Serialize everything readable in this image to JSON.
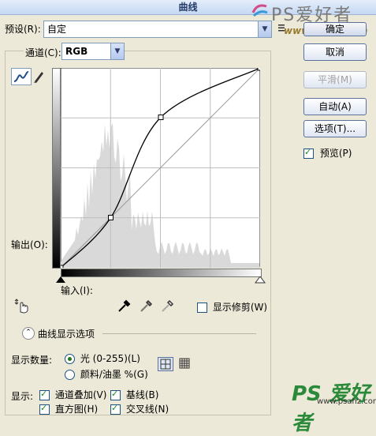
{
  "window": {
    "title": "曲线"
  },
  "preset": {
    "label": "预设(R):",
    "value": "自定"
  },
  "preset_menu_icon": "menu-icon",
  "channel": {
    "label": "通道(C):",
    "value": "RGB"
  },
  "graph": {
    "output_label": "输出(O):",
    "input_label": "输入(I):",
    "points": [
      [
        0,
        0
      ],
      [
        64,
        64
      ],
      [
        128,
        192
      ],
      [
        255,
        255
      ]
    ]
  },
  "buttons": {
    "ok": "确定",
    "cancel": "取消",
    "smooth": "平滑(M)",
    "auto": "自动(A)",
    "options": "选项(T)..."
  },
  "preview": {
    "label": "预览(P)",
    "checked": true
  },
  "show_clipping": {
    "label": "显示修剪(W)",
    "checked": false
  },
  "display_options": {
    "label": "曲线显示选项"
  },
  "show_amount": {
    "label": "显示数量:",
    "light": "光 (0-255)(L)",
    "pigment": "颜料/油墨 %(G)"
  },
  "show": {
    "label": "显示:",
    "channel_overlay": "通道叠加(V)",
    "baseline": "基线(B)",
    "histogram": "直方图(H)",
    "intersection": "交叉线(N)"
  },
  "watermarks": {
    "top_brand": "PS爱好者",
    "site": "www.ps2000.cn",
    "bottom_brand": "PS 爱好者",
    "bottom_url": "www.psahz.com"
  }
}
